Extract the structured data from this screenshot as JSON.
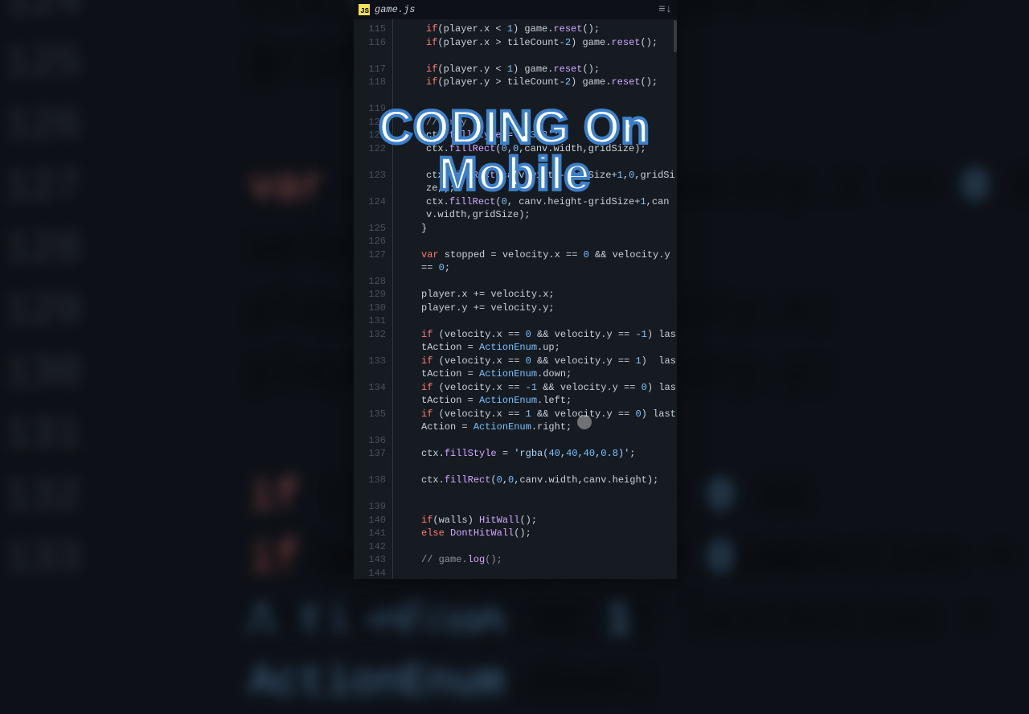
{
  "tab": {
    "filename": "game.js",
    "icon_label": "JS"
  },
  "overlay": {
    "line1": "CODING On",
    "line2": "Mobile"
  },
  "code_lines": [
    {
      "n": "115",
      "t": "        if(player.x < 1) game.reset();",
      "cls": "dim"
    },
    {
      "n": "116",
      "t": "        if(player.x > tileCount-2) game.reset();"
    },
    {
      "n": "117",
      "t": "        if(player.y < 1) game.reset();"
    },
    {
      "n": "118",
      "t": "        if(player.y > tileCount-2) game.reset();"
    },
    {
      "n": "119",
      "t": ""
    },
    {
      "n": "120",
      "t": "        // grey"
    },
    {
      "n": "121",
      "t": "        ctx.fillStyle = '#333';"
    },
    {
      "n": "122",
      "t": "        ctx.fillRect(0,0,canv.width,gridSize);"
    },
    {
      "n": "123",
      "t": "        ctx.fillRect(canv.width-gridSize+1,0,gridSize,);"
    },
    {
      "n": "124",
      "t": "        ctx.fillRect(0, canv.height-gridSize+1,canv.width,gridSize);"
    },
    {
      "n": "125",
      "t": "      }"
    },
    {
      "n": "126",
      "t": ""
    },
    {
      "n": "127",
      "t": "      var stopped = velocity.x == 0 && velocity.y == 0;"
    },
    {
      "n": "128",
      "t": ""
    },
    {
      "n": "129",
      "t": "      player.x += velocity.x;"
    },
    {
      "n": "130",
      "t": "      player.y += velocity.y;"
    },
    {
      "n": "131",
      "t": ""
    },
    {
      "n": "132",
      "t": "      if (velocity.x == 0 && velocity.y == -1) lastAction = ActionEnum.up;"
    },
    {
      "n": "133",
      "t": "      if (velocity.x == 0 && velocity.y == 1)  lastAction = ActionEnum.down;"
    },
    {
      "n": "134",
      "t": "      if (velocity.x == -1 && velocity.y == 0) lastAction = ActionEnum.left;"
    },
    {
      "n": "135",
      "t": "      if (velocity.x == 1 && velocity.y == 0) lastAction = ActionEnum.right;"
    },
    {
      "n": "136",
      "t": ""
    },
    {
      "n": "137",
      "t": "      ctx.fillStyle = 'rgba(40,40,40,0.8)';"
    },
    {
      "n": "138",
      "t": "      ctx.fillRect(0,0,canv.width,canv.height);"
    },
    {
      "n": "139",
      "t": ""
    },
    {
      "n": "140",
      "t": "      if(walls) HitWall();"
    },
    {
      "n": "141",
      "t": "      else DontHitWall();"
    },
    {
      "n": "142",
      "t": ""
    },
    {
      "n": "143",
      "t": "      // game.log();"
    },
    {
      "n": "144",
      "t": ""
    }
  ],
  "bg_lines": [
    {
      "n": "124",
      "t": "    ctx.fillRect(0, canv.height-gridSize);"
    },
    {
      "n": "125",
      "t": "  }"
    },
    {
      "n": "126",
      "t": ""
    },
    {
      "n": "127",
      "t": "  var stopped = velocity.x == 0 && velocity.y == 0;"
    },
    {
      "n": "128",
      "t": ""
    },
    {
      "n": "129",
      "t": "  player.x += velocity.x;"
    },
    {
      "n": "130",
      "t": "  player.y += velocity.y;"
    },
    {
      "n": "131",
      "t": ""
    },
    {
      "n": "132",
      "t": "  if (velocity.x == 0 && velocity.y == -1) lastAction = ActionEnum.up;"
    },
    {
      "n": "133",
      "t": "  if (velocity.x == 0 && velocity.y == 1)  lastAction = ActionEnum.down;"
    }
  ],
  "colors": {
    "keyword": "#ff7b72",
    "class": "#79c0ff",
    "string": "#a5d6ff",
    "comment": "#8b949e"
  }
}
